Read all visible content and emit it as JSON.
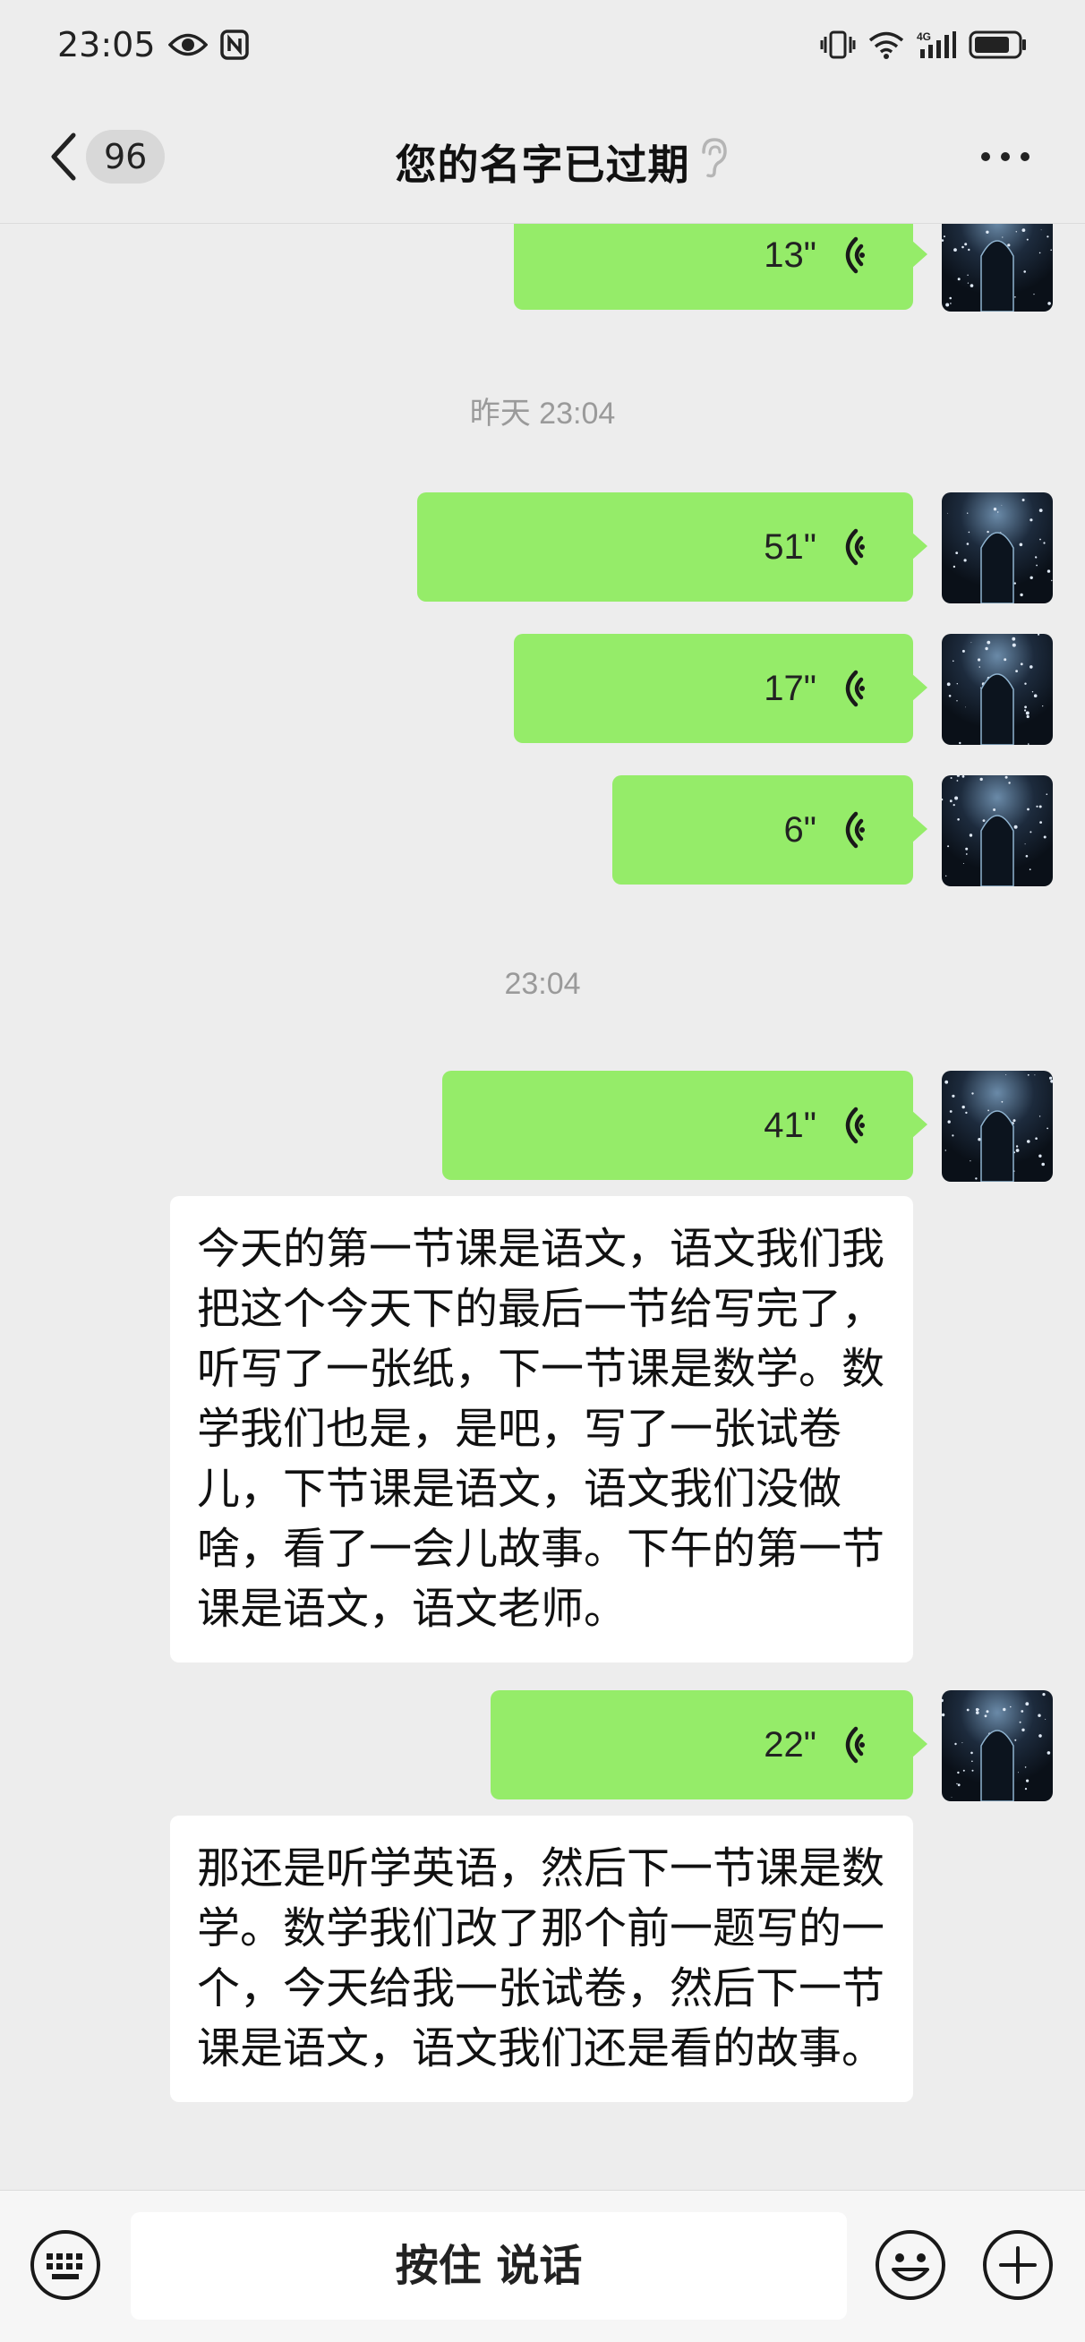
{
  "status_bar": {
    "time": "23:05"
  },
  "nav": {
    "unread_count": "96",
    "title": "您的名字已过期"
  },
  "messages": [
    {
      "type": "voice",
      "duration": "13\""
    },
    {
      "type": "timestamp",
      "text": "昨天 23:04"
    },
    {
      "type": "voice",
      "duration": "51\""
    },
    {
      "type": "voice",
      "duration": "17\""
    },
    {
      "type": "voice",
      "duration": "6\""
    },
    {
      "type": "timestamp",
      "text": "23:04"
    },
    {
      "type": "voice",
      "duration": "41\""
    },
    {
      "type": "transcript",
      "text": "今天的第一节课是语文，语文我们我把这个今天下的最后一节给写完了，听写了一张纸，下一节课是数学。数学我们也是，是吧，写了一张试卷儿，下节课是语文，语文我们没做啥，看了一会儿故事。下午的第一节课是语文，语文老师。"
    },
    {
      "type": "voice",
      "duration": "22\""
    },
    {
      "type": "transcript",
      "text": "那还是听学英语，然后下一节课是数学。数学我们改了那个前一题写的一个，今天给我一张试卷，然后下一节课是语文，语文我们还是看的故事。"
    }
  ],
  "input_bar": {
    "hold_to_talk_label": "按住 说话"
  },
  "colors": {
    "voice_bubble": "#95ec69",
    "background": "#ededed",
    "text_bubble": "#ffffff"
  },
  "icons": [
    "eye-icon",
    "nfc-icon",
    "vibrate-icon",
    "wifi-icon",
    "signal-4g-icon",
    "battery-icon",
    "back-icon",
    "ear-icon",
    "more-icon",
    "voice-wave-icon",
    "keyboard-icon",
    "emoji-icon",
    "plus-icon"
  ]
}
